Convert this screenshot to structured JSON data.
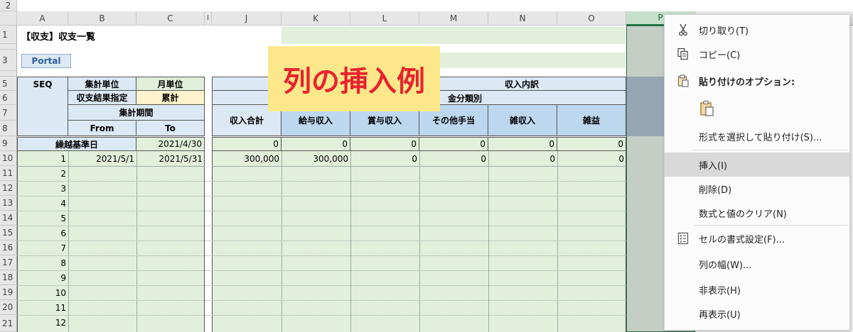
{
  "column_headers": [
    "A",
    "B",
    "C",
    "I",
    "J",
    "K",
    "L",
    "M",
    "N",
    "O",
    "P"
  ],
  "row_numbers": [
    "1",
    "2",
    "3",
    "5",
    "6",
    "7",
    "8",
    "9",
    "10",
    "11",
    "12",
    "13",
    "14",
    "15",
    "16",
    "17",
    "18",
    "19",
    "20",
    "21"
  ],
  "sheet": {
    "title": "【収支】収支一覧",
    "portal_button": "Portal",
    "seq": "SEQ",
    "unit_label": "集計単位",
    "unit_value": "月単位",
    "result_label": "収支結果指定",
    "result_value": "累計",
    "period_label": "集計期間",
    "from_label": "From",
    "to_label": "To",
    "carry_label": "繰越基準日",
    "carry_date": "2021/4/30",
    "income_breakdown": "収入内訳",
    "category_label": "金分類別",
    "cols": [
      "収入合計",
      "給与収入",
      "賞与収入",
      "その他手当",
      "雑収入",
      "雑益"
    ],
    "zero": "0",
    "row1_from": "2021/5/1",
    "row1_to": "2021/5/31",
    "row1_total": "300,000",
    "row1_salary": "300,000",
    "seq_numbers": [
      "1",
      "2",
      "3",
      "4",
      "5",
      "6",
      "7",
      "8",
      "9",
      "10",
      "11",
      "12"
    ]
  },
  "overlay": {
    "text": "列の挿入例",
    "bg": "#fce88a",
    "color": "#e8232f"
  },
  "context_menu": {
    "cut": "切り取り(T)",
    "copy": "コピー(C)",
    "paste_options": "貼り付けのオプション:",
    "paste_special": "形式を選択して貼り付け(S)...",
    "insert": "挿入(I)",
    "delete": "削除(D)",
    "clear": "数式と値のクリア(N)",
    "format_cells": "セルの書式設定(F)...",
    "column_width": "列の幅(W)...",
    "hide": "非表示(H)",
    "unhide": "再表示(U)"
  }
}
